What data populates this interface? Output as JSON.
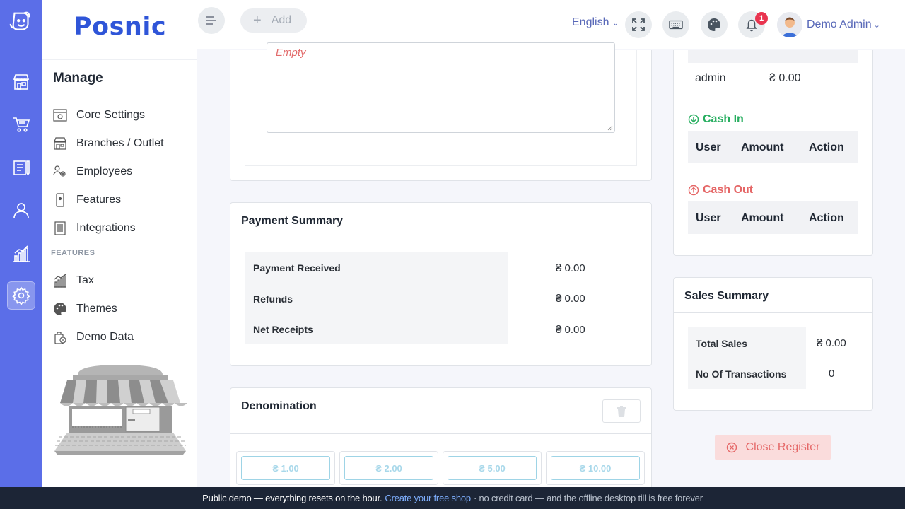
{
  "app": {
    "brand": "Posnic"
  },
  "colors": {
    "rail": "#5b6ee8",
    "brand": "#2f55d8",
    "accent": "#5868b8",
    "cash_in": "#27ae60",
    "cash_out": "#e56767",
    "danger_badge": "#e9344f"
  },
  "rail": {
    "items": [
      {
        "icon": "shop-icon"
      },
      {
        "icon": "cart-icon"
      },
      {
        "icon": "clipboard-icon"
      },
      {
        "icon": "user-icon"
      },
      {
        "icon": "chart-icon"
      },
      {
        "icon": "settings-icon",
        "active": true
      }
    ]
  },
  "panel": {
    "title": "Manage",
    "menu": [
      {
        "label": "Core Settings",
        "icon": "settings-panel-icon"
      },
      {
        "label": "Branches / Outlet",
        "icon": "store-icon"
      },
      {
        "label": "Employees",
        "icon": "employees-icon"
      },
      {
        "label": "Features",
        "icon": "mobile-icon"
      },
      {
        "label": "Integrations",
        "icon": "document-icon"
      }
    ],
    "features_heading": "FEATURES",
    "features_menu": [
      {
        "label": "Tax",
        "icon": "tax-chart-icon"
      },
      {
        "label": "Themes",
        "icon": "palette-icon"
      },
      {
        "label": "Demo Data",
        "icon": "demo-data-icon"
      }
    ]
  },
  "topbar": {
    "add_label": "Add",
    "language": "English",
    "notifications_count": "1",
    "user_name": "Demo Admin"
  },
  "notes": {
    "empty_text": "Empty"
  },
  "payment_summary": {
    "title": "Payment Summary",
    "rows": [
      {
        "label": "Payment Received",
        "value": "₴  0.00"
      },
      {
        "label": "Refunds",
        "value": "₴  0.00"
      },
      {
        "label": "Net Receipts",
        "value": "₴  0.00"
      }
    ]
  },
  "denomination": {
    "title": "Denomination",
    "buttons": [
      "₴ 1.00",
      "₴ 2.00",
      "₴ 5.00",
      "₴ 10.00"
    ]
  },
  "register": {
    "opening": {
      "user": "admin",
      "amount": "₴ 0.00"
    },
    "cash_in": {
      "label": "Cash In",
      "columns": [
        "User",
        "Amount",
        "Action"
      ]
    },
    "cash_out": {
      "label": "Cash Out",
      "columns": [
        "User",
        "Amount",
        "Action"
      ]
    }
  },
  "sales_summary": {
    "title": "Sales Summary",
    "total_sales_label": "Total Sales",
    "total_sales_value": "₴ 0.00",
    "transactions_label": "No Of Transactions",
    "transactions_value": "0"
  },
  "close_register_label": "Close Register",
  "footer": {
    "text": "Public demo — everything resets on the hour.",
    "link": "Create your free shop",
    "muted": "· no credit card — and the offline desktop till is free forever"
  }
}
